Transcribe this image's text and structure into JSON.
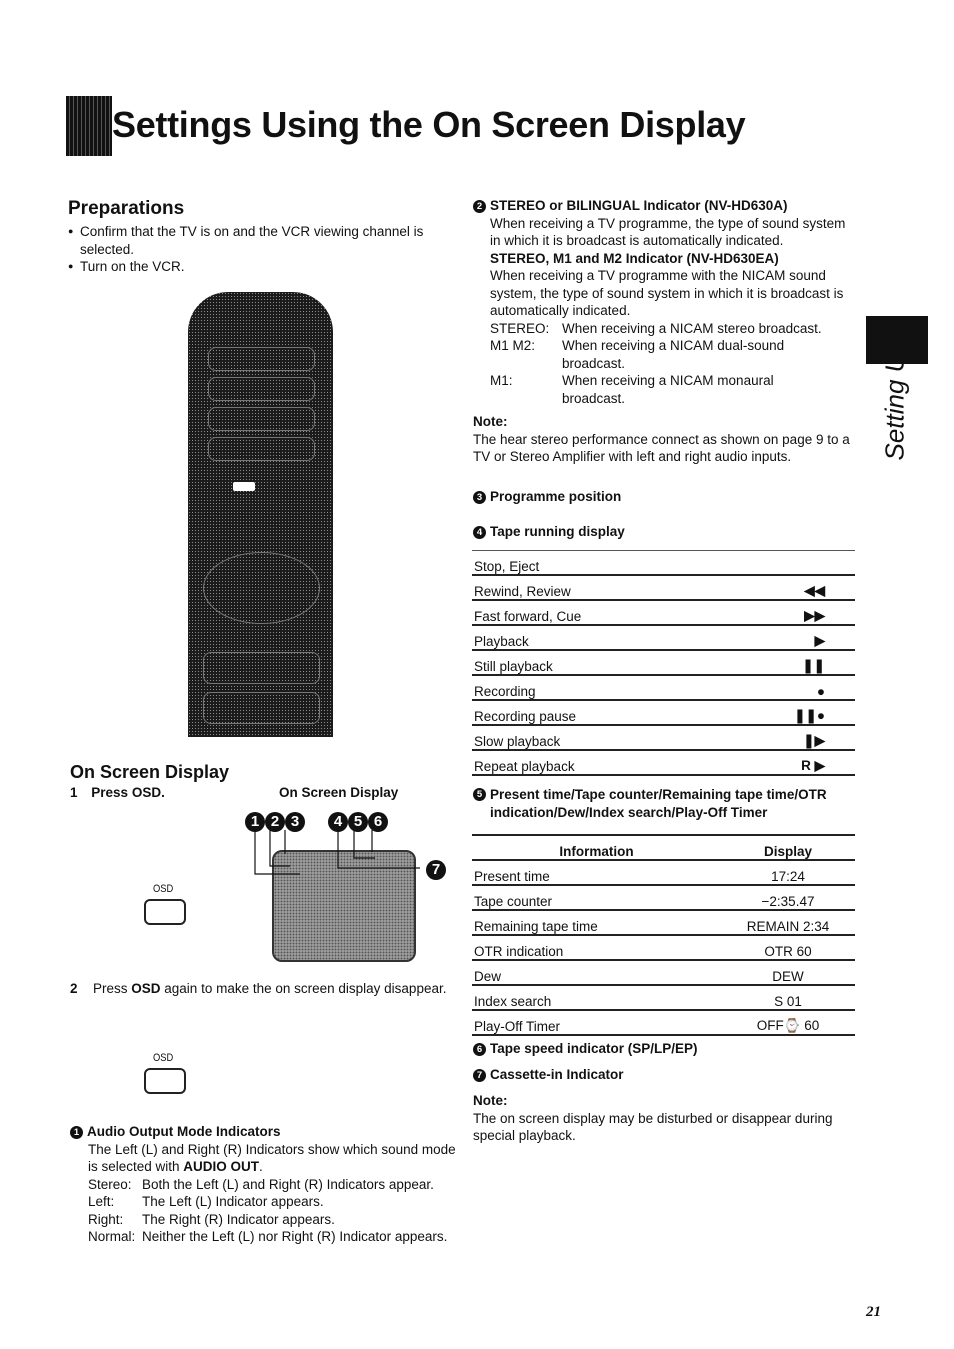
{
  "header": {
    "title": "Settings Using the On Screen Display"
  },
  "side_tab": {
    "label": "Setting Up"
  },
  "page_number": "21",
  "preparations": {
    "heading": "Preparations",
    "bullets": [
      "Confirm that the TV is on and the VCR viewing channel is selected.",
      "Turn on the VCR."
    ]
  },
  "osd_section": {
    "heading": "On Screen Display",
    "step1": {
      "num": "1",
      "text": "Press OSD."
    },
    "figure_caption": "On Screen Display",
    "callouts": [
      "1",
      "2",
      "3",
      "4",
      "5",
      "6",
      "7"
    ],
    "key_label": "OSD",
    "step2": {
      "num": "2",
      "pre": "Press ",
      "bold": "OSD",
      "post": " again to make the on screen display disappear."
    },
    "key_label2": "OSD"
  },
  "item1": {
    "num": "1",
    "heading": "Audio Output Mode Indicators",
    "intro_pre": "The Left (L) and Right (R) Indicators show which sound mode is selected with ",
    "intro_bold": "AUDIO OUT",
    "intro_post": ".",
    "defs": [
      {
        "k": "Stereo:",
        "v": "Both the Left (L) and Right (R) Indicators appear."
      },
      {
        "k": "Left:",
        "v": "The Left (L) Indicator appears."
      },
      {
        "k": "Right:",
        "v": "The Right (R) Indicator appears."
      },
      {
        "k": "Normal:",
        "v": "Neither the Left (L) nor Right (R) Indicator appears."
      }
    ]
  },
  "item2": {
    "num": "2",
    "heading": "STEREO or BILINGUAL Indicator (NV-HD630A)",
    "text1": "When receiving a TV programme, the type of sound system in which it is broadcast is automatically indicated.",
    "subheading": "STEREO, M1 and M2 Indicator (NV-HD630EA)",
    "text2": "When receiving a TV programme with the NICAM sound system, the type of sound system in which it is broadcast is automatically indicated.",
    "defs": [
      {
        "k": "STEREO:",
        "v": "When receiving a NICAM stereo broadcast."
      },
      {
        "k": "M1 M2:",
        "v": "When receiving a NICAM dual-sound broadcast."
      },
      {
        "k": "M1:",
        "v": "When receiving a NICAM monaural broadcast."
      }
    ],
    "note_label": "Note:",
    "note_text": "The hear stereo performance connect as shown on page 9 to a TV or Stereo Amplifier with left and right audio inputs."
  },
  "item3": {
    "num": "3",
    "heading": "Programme position"
  },
  "item4": {
    "num": "4",
    "heading": "Tape running display",
    "rows": [
      {
        "label": "Stop, Eject",
        "symbol": ""
      },
      {
        "label": "Rewind, Review",
        "symbol": "◀◀"
      },
      {
        "label": "Fast forward, Cue",
        "symbol": "▶▶"
      },
      {
        "label": "Playback",
        "symbol": "▶"
      },
      {
        "label": "Still playback",
        "symbol": "❚❚"
      },
      {
        "label": "Recording",
        "symbol": "●"
      },
      {
        "label": "Recording pause",
        "symbol": "❚❚●"
      },
      {
        "label": "Slow playback",
        "symbol": "❚▶"
      },
      {
        "label": "Repeat playback",
        "symbol": "R ▶"
      }
    ]
  },
  "item5": {
    "num": "5",
    "heading": "Present time/Tape counter/Remaining tape time/OTR indication/Dew/Index search/Play-Off Timer",
    "columns": [
      "Information",
      "Display"
    ],
    "rows": [
      {
        "info": "Present time",
        "display": "17:24"
      },
      {
        "info": "Tape counter",
        "display": "−2:35.47"
      },
      {
        "info": "Remaining tape time",
        "display": "REMAIN 2:34"
      },
      {
        "info": "OTR indication",
        "display": "OTR 60"
      },
      {
        "info": "Dew",
        "display": "DEW"
      },
      {
        "info": "Index search",
        "display": "S 01"
      },
      {
        "info": "Play-Off Timer",
        "display": "OFF⌚ 60"
      }
    ]
  },
  "item6": {
    "num": "6",
    "heading": "Tape speed indicator (SP/LP/EP)"
  },
  "item7": {
    "num": "7",
    "heading": "Cassette-in Indicator"
  },
  "final_note": {
    "label": "Note:",
    "text": "The on screen display may be disturbed or disappear during special playback."
  }
}
